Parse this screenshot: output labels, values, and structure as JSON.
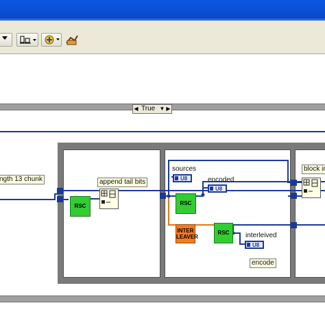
{
  "case_structure": {
    "selector_value": "True"
  },
  "labels": {
    "chunk": "ngth 13 chunk",
    "append_tail": "append tail bits",
    "sources": "sources",
    "encoded": "encoded",
    "interleived": "interleived",
    "encode": "encode",
    "block_in": "block in"
  },
  "blocks": {
    "rsc": "RSC",
    "interleaver_line1": "INTER",
    "interleaver_line2": "LEAVER"
  },
  "indicators": {
    "type": "U8"
  },
  "icons": [
    "menu-arrow-icon",
    "align-objects-icon",
    "distribute-objects-icon",
    "reorder-icon",
    "cleanup-diagram-icon"
  ],
  "colors": {
    "titlebar": "#0b4fd6",
    "wire_u8": "#1a3a9a",
    "wire_orange": "#e07818",
    "rsc": "#33cc33",
    "interleaver": "#f57a1f"
  }
}
